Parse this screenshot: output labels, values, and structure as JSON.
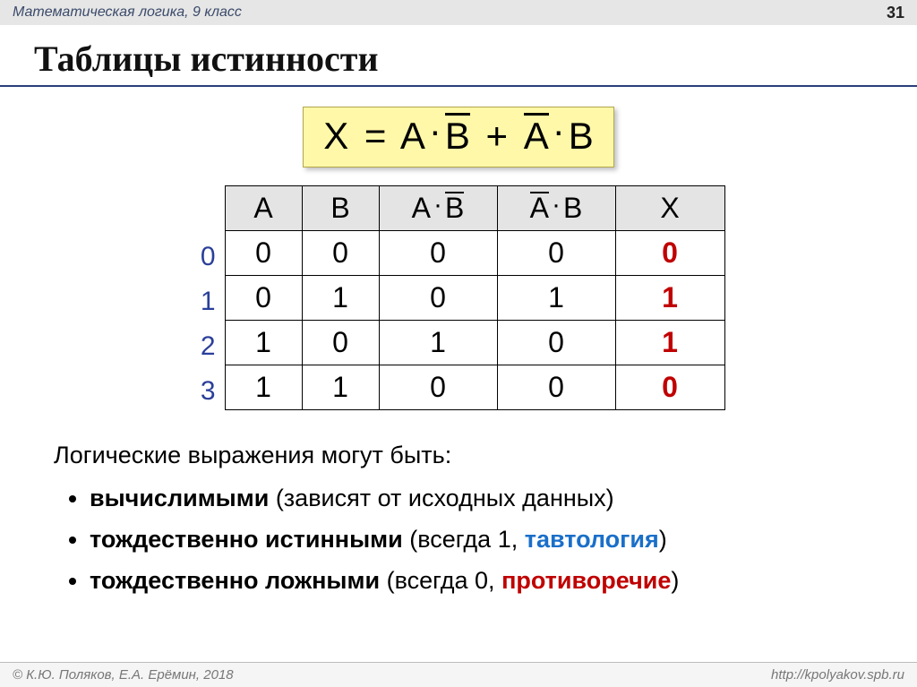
{
  "header": {
    "course": "Математическая логика, 9 класс",
    "page_number": "31"
  },
  "title": "Таблицы истинности",
  "formula": {
    "lhs": "X",
    "eq": "=",
    "term1_a": "A",
    "term1_b": "B",
    "plus": "+",
    "term2_a": "A",
    "term2_b": "B"
  },
  "table": {
    "headers": {
      "A": "A",
      "B": "B",
      "AB": {
        "a": "A",
        "b": "B"
      },
      "AB2": {
        "a": "A",
        "b": "B"
      },
      "X": "X"
    },
    "row_labels": [
      "0",
      "1",
      "2",
      "3"
    ],
    "rows": [
      {
        "A": "0",
        "B": "0",
        "AB": "0",
        "AB2": "0",
        "X": "0"
      },
      {
        "A": "0",
        "B": "1",
        "AB": "0",
        "AB2": "1",
        "X": "1"
      },
      {
        "A": "1",
        "B": "0",
        "AB": "1",
        "AB2": "0",
        "X": "1"
      },
      {
        "A": "1",
        "B": "1",
        "AB": "0",
        "AB2": "0",
        "X": "0"
      }
    ]
  },
  "text": {
    "intro": "Логические выражения могут быть:",
    "bullet1_bold": "вычислимыми",
    "bullet1_rest": " (зависят от исходных данных)",
    "bullet2_bold": "тождественно истинными",
    "bullet2_mid": " (всегда 1, ",
    "bullet2_term": "тавтология",
    "bullet2_end": ")",
    "bullet3_bold": "тождественно ложными",
    "bullet3_mid": " (всегда 0, ",
    "bullet3_term": "противоречие",
    "bullet3_end": ")"
  },
  "footer": {
    "left": "© К.Ю. Поляков, Е.А. Ерёмин, 2018",
    "right": "http://kpolyakov.spb.ru"
  }
}
